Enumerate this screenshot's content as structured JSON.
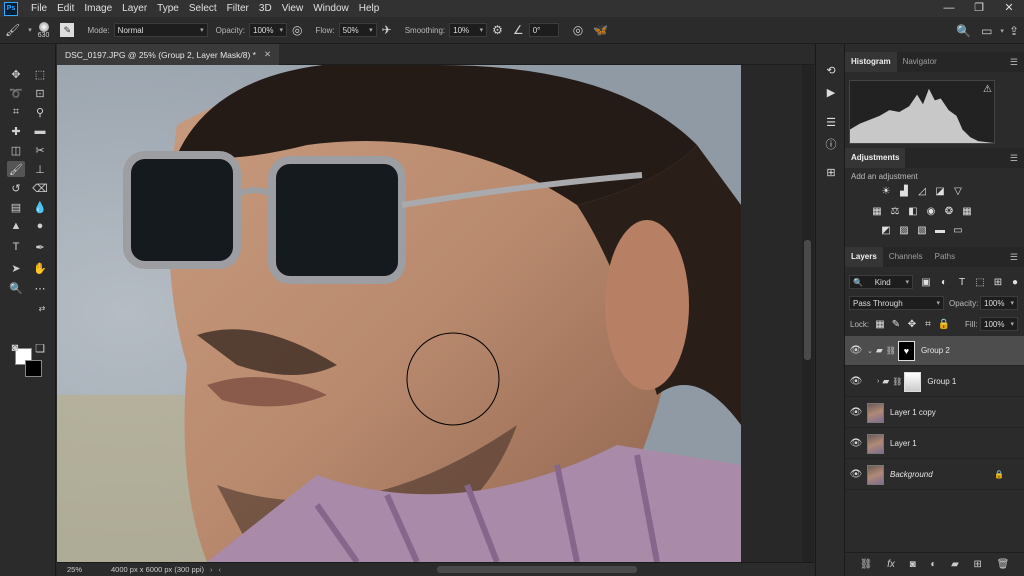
{
  "menubar": {
    "logo": "Ps",
    "items": [
      "File",
      "Edit",
      "Image",
      "Layer",
      "Type",
      "Select",
      "Filter",
      "3D",
      "View",
      "Window",
      "Help"
    ],
    "window_controls": [
      "—",
      "❐",
      "✕"
    ]
  },
  "options": {
    "brush_size": "630",
    "mode_label": "Mode:",
    "mode_value": "Normal",
    "opacity_label": "Opacity:",
    "opacity_value": "100%",
    "flow_label": "Flow:",
    "flow_value": "50%",
    "smoothing_label": "Smoothing:",
    "smoothing_value": "10%",
    "angle_value": "0°"
  },
  "document": {
    "tab_title": "DSC_0197.JPG @ 25% (Group 2, Layer Mask/8) *",
    "zoom": "25%",
    "doc_info": "4000 px x 6000 px (300 ppi)"
  },
  "panels": {
    "top_tabs": [
      "Histogram",
      "Navigator"
    ],
    "adjustments_tab": "Adjustments",
    "add_adjustment": "Add an adjustment",
    "layer_tabs": [
      "Layers",
      "Channels",
      "Paths"
    ],
    "filter_kind": "Kind",
    "blend_mode": "Pass Through",
    "opacity_label": "Opacity:",
    "opacity_value": "100%",
    "lock_label": "Lock:",
    "fill_label": "Fill:",
    "fill_value": "100%",
    "layers": [
      {
        "name": "Group 2",
        "type": "group",
        "selected": true
      },
      {
        "name": "Group 1",
        "type": "group",
        "selected": false
      },
      {
        "name": "Layer 1 copy",
        "type": "pixel",
        "selected": false
      },
      {
        "name": "Layer 1",
        "type": "pixel",
        "selected": false
      },
      {
        "name": "Background",
        "type": "background",
        "selected": false,
        "locked": true
      }
    ]
  },
  "colors": {
    "accent": "#31a8ff",
    "foreground": "#ffffff",
    "background": "#000000"
  }
}
